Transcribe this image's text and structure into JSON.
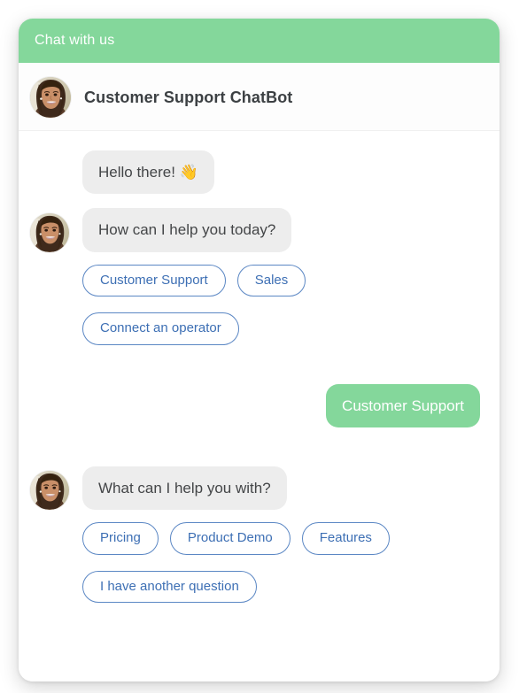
{
  "header": {
    "title": "Chat with us"
  },
  "bot": {
    "name": "Customer Support ChatBot",
    "avatar_icon": "woman-avatar-photo"
  },
  "messages": [
    {
      "sender": "bot",
      "text": "Hello there! 👋"
    },
    {
      "sender": "bot",
      "text": "How can I help you today?"
    },
    {
      "sender": "user",
      "text": "Customer Support"
    },
    {
      "sender": "bot",
      "text": "What can I help you with?"
    }
  ],
  "quick_replies_first": [
    "Customer Support",
    "Sales",
    "Connect an operator"
  ],
  "quick_replies_second": [
    "Pricing",
    "Product Demo",
    "Features",
    "I have another question"
  ],
  "colors": {
    "header_green": "#84d79b",
    "user_bubble_green": "#84d79b",
    "bot_bubble_gray": "#ededed",
    "chip_blue": "#3d6fb4",
    "chip_border_blue": "#5b87c4",
    "title_text": "#3c4043"
  }
}
